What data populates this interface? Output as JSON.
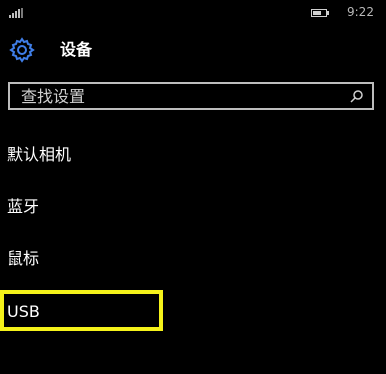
{
  "status": {
    "time": "9:22",
    "signal_icon": "signal-icon",
    "battery_icon": "battery-icon"
  },
  "header": {
    "title": "设备",
    "icon": "gear-icon",
    "accent": "#3f7ee8"
  },
  "search": {
    "placeholder": "查找设置",
    "icon": "search-icon"
  },
  "menu": [
    {
      "label": "默认相机"
    },
    {
      "label": "蓝牙"
    },
    {
      "label": "鼠标"
    },
    {
      "label": "USB"
    }
  ],
  "highlight": {
    "color": "#f5f21a",
    "item": "USB"
  }
}
